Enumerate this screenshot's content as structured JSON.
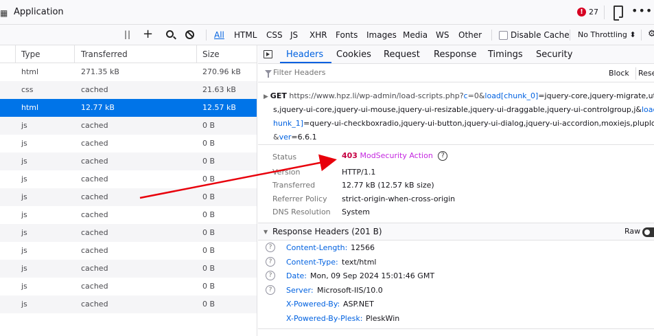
{
  "window": {
    "app_icon": "grid-icon",
    "title": "Application",
    "error_count": "27",
    "error_icon_glyph": "!",
    "more_glyph": "•••"
  },
  "toolbar": {
    "filter_types": [
      "All",
      "HTML",
      "CSS",
      "JS",
      "XHR",
      "Fonts",
      "Images",
      "Media",
      "WS",
      "Other"
    ],
    "disable_cache_label": "Disable Cache",
    "throttling_label": "No Throttling ⬍",
    "last_glyph": "⚙"
  },
  "table": {
    "columns": [
      "Type",
      "Transferred",
      "Size"
    ],
    "rows": [
      {
        "type": "html",
        "transferred": "271.35 kB",
        "size": "270.96 kB"
      },
      {
        "type": "css",
        "transferred": "cached",
        "size": "21.63 kB"
      },
      {
        "type": "html",
        "transferred": "12.77 kB",
        "size": "12.57 kB"
      },
      {
        "type": "js",
        "transferred": "cached",
        "size": "0 B"
      },
      {
        "type": "js",
        "transferred": "cached",
        "size": "0 B"
      },
      {
        "type": "js",
        "transferred": "cached",
        "size": "0 B"
      },
      {
        "type": "js",
        "transferred": "cached",
        "size": "0 B"
      },
      {
        "type": "js",
        "transferred": "cached",
        "size": "0 B"
      },
      {
        "type": "js",
        "transferred": "cached",
        "size": "0 B"
      },
      {
        "type": "js",
        "transferred": "cached",
        "size": "0 B"
      },
      {
        "type": "js",
        "transferred": "cached",
        "size": "0 B"
      },
      {
        "type": "js",
        "transferred": "cached",
        "size": "0 B"
      },
      {
        "type": "js",
        "transferred": "cached",
        "size": "0 B"
      },
      {
        "type": "js",
        "transferred": "cached",
        "size": "0 B"
      }
    ],
    "selected_index": 2
  },
  "panel": {
    "tabs": [
      "Headers",
      "Cookies",
      "Request",
      "Response",
      "Timings",
      "Security"
    ],
    "active_tab": "Headers",
    "filter_placeholder": "Filter Headers",
    "block_label": "Block",
    "resend_label": "Rese",
    "request": {
      "method": "GET",
      "lines": [
        [
          {
            "t": "https://www.hpz.li/wp-admin/load-scripts.php?",
            "c": "u"
          },
          {
            "t": "c",
            "c": "k"
          },
          {
            "t": "=0&",
            "c": "u"
          },
          {
            "t": "load[chunk_0]",
            "c": "k"
          },
          {
            "t": "=jquery-core,jquery-migrate,util",
            "c": "t"
          }
        ],
        [
          {
            "t": "s,jquery-ui-core,jquery-ui-mouse,jquery-ui-resizable,jquery-ui-draggable,jquery-ui-controlgroup,j&",
            "c": "t"
          },
          {
            "t": "load[c",
            "c": "k"
          }
        ],
        [
          {
            "t": "hunk_1]",
            "c": "k"
          },
          {
            "t": "=query-ui-checkboxradio,jquery-ui-button,jquery-ui-dialog,jquery-ui-accordion,moxiejs,plupload",
            "c": "t"
          }
        ],
        [
          {
            "t": "&",
            "c": "u"
          },
          {
            "t": "ver",
            "c": "k"
          },
          {
            "t": "=6.6.1",
            "c": "t"
          }
        ]
      ]
    },
    "status": {
      "status_label": "Status",
      "status_code": "403",
      "status_text": "ModSecurity Action",
      "help_glyph": "?",
      "version_label": "Version",
      "version_value": "HTTP/1.1",
      "transferred_label": "Transferred",
      "transferred_value": "12.77 kB (12.57 kB size)",
      "referrer_label": "Referrer Policy",
      "referrer_value": "strict-origin-when-cross-origin",
      "dns_label": "DNS Resolution",
      "dns_value": "System"
    },
    "response_headers": {
      "title": "Response Headers (201 B)",
      "raw_label": "Raw",
      "items": [
        {
          "name": "Content-Length:",
          "value": "12566",
          "help": true
        },
        {
          "name": "Content-Type:",
          "value": "text/html",
          "help": true
        },
        {
          "name": "Date:",
          "value": "Mon, 09 Sep 2024 15:01:46 GMT",
          "help": true
        },
        {
          "name": "Server:",
          "value": "Microsoft-IIS/10.0",
          "help": true
        },
        {
          "name": "X-Powered-By:",
          "value": "ASP.NET",
          "help": false
        },
        {
          "name": "X-Powered-By-Plesk:",
          "value": "PleskWin",
          "help": false
        }
      ]
    }
  },
  "colors": {
    "accent": "#0061e0",
    "selected_row": "#0074e8",
    "error": "#d70022",
    "arrow": "#e8000b",
    "status_text": "#c427e0"
  }
}
